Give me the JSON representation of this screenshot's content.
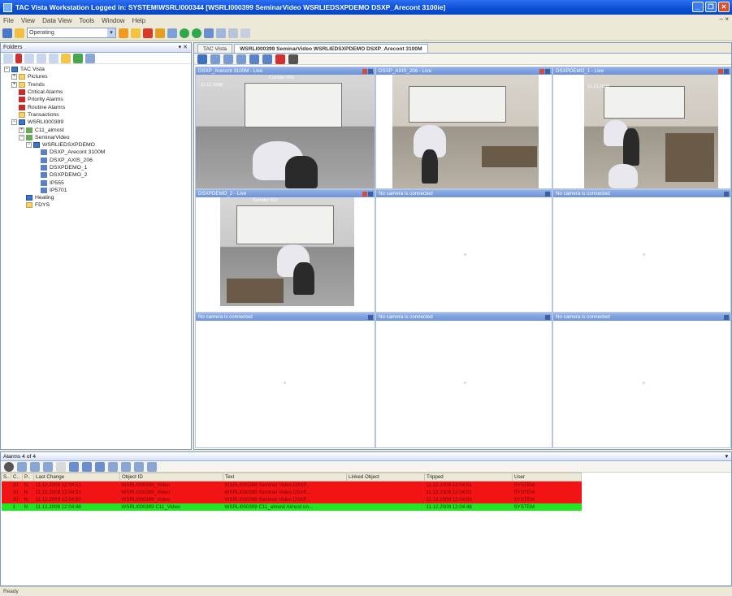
{
  "window": {
    "title": "TAC Vista Workstation   Logged in: SYSTEM\\WSRLI000344   [WSRLI000399 SeminarVideo WSRLIEDSXPDEMO DSXP_Arecont 3100ie]"
  },
  "menu": {
    "items": [
      "File",
      "View",
      "Data View",
      "Tools",
      "Window",
      "Help"
    ]
  },
  "toolbar": {
    "mode_value": "Operating"
  },
  "folders": {
    "title": "Folders",
    "tree": [
      {
        "label": "TAC Vista",
        "icon": "comp",
        "depth": 0,
        "expander": "−"
      },
      {
        "label": "Pictures",
        "icon": "folder",
        "depth": 1,
        "expander": "+"
      },
      {
        "label": "Trends",
        "icon": "folder",
        "depth": 1,
        "expander": "+"
      },
      {
        "label": "Critical Alarms",
        "icon": "alarm",
        "depth": 1,
        "expander": ""
      },
      {
        "label": "Priority Alarms",
        "icon": "alarm",
        "depth": 1,
        "expander": ""
      },
      {
        "label": "Routine Alarms",
        "icon": "alarm",
        "depth": 1,
        "expander": ""
      },
      {
        "label": "Transactions",
        "icon": "folder",
        "depth": 1,
        "expander": ""
      },
      {
        "label": "WSRLI000399",
        "icon": "comp",
        "depth": 1,
        "expander": "−"
      },
      {
        "label": "C11_almost",
        "icon": "net",
        "depth": 2,
        "expander": "+"
      },
      {
        "label": "SeminarVideo",
        "icon": "net",
        "depth": 2,
        "expander": "−"
      },
      {
        "label": "WSRLIEDSXPDEMO",
        "icon": "comp",
        "depth": 3,
        "expander": "−"
      },
      {
        "label": "DSXP_Arecont 3100M",
        "icon": "cam",
        "depth": 4,
        "expander": ""
      },
      {
        "label": "DSXP_AXIS_206",
        "icon": "cam",
        "depth": 4,
        "expander": ""
      },
      {
        "label": "DSXPDEMO_1",
        "icon": "cam",
        "depth": 4,
        "expander": ""
      },
      {
        "label": "DSXPDEMO_2",
        "icon": "cam",
        "depth": 4,
        "expander": ""
      },
      {
        "label": "IP555",
        "icon": "cam",
        "depth": 4,
        "expander": ""
      },
      {
        "label": "IP5701",
        "icon": "cam",
        "depth": 4,
        "expander": ""
      },
      {
        "label": "Heating",
        "icon": "comp",
        "depth": 2,
        "expander": ""
      },
      {
        "label": "FDYS",
        "icon": "folder",
        "depth": 2,
        "expander": ""
      }
    ]
  },
  "video": {
    "tabs": [
      "TAC Vista",
      "WSRLI000399 SeminarVideo WSRLIEDSXPDEMO DSXP_Arecont 3100M"
    ],
    "cells": [
      {
        "title": "DSXP_Arecont 3100M - Live",
        "osd": "11.12.2008",
        "osd2": "Corridor 003"
      },
      {
        "title": "DSXP_AXIS_206 - Live",
        "osd": "",
        "osd2": ""
      },
      {
        "title": "DSXPDEMO_1 - Live",
        "osd": "11.12.2008",
        "osd2": ""
      },
      {
        "title": "DSXPDEMO_2 - Live",
        "osd": "",
        "osd2": "Corridor 003"
      },
      {
        "title": "No camera is connected",
        "osd": "",
        "osd2": ""
      },
      {
        "title": "No camera is connected",
        "osd": "",
        "osd2": ""
      },
      {
        "title": "No camera is connected",
        "osd": "",
        "osd2": ""
      },
      {
        "title": "No camera is connected",
        "osd": "",
        "osd2": ""
      },
      {
        "title": "No camera is connected",
        "osd": "",
        "osd2": ""
      }
    ]
  },
  "alarms": {
    "title": "Alarms 4 of 4",
    "columns": [
      "S..",
      "C..",
      "P..",
      "Last Change",
      "Object ID",
      "Text",
      "Linked Object",
      "Tripped",
      "User"
    ],
    "rows": [
      {
        "status": "red",
        "cells": [
          "",
          "10",
          "N",
          "11.12.2008 12:04:51",
          "WSRLI000399_Video",
          "WSRLI000399 Seminar Video DSXP...",
          "",
          "11.12.2008 12:04:51",
          "SYSTEM"
        ]
      },
      {
        "status": "red",
        "cells": [
          "",
          "10",
          "N",
          "11.12.2008 12:04:51",
          "WSRLI000399_Video",
          "WSRLI000399 Seminar Video DSXP...",
          "",
          "11.12.2008 12:04:51",
          "SYSTEM"
        ]
      },
      {
        "status": "red",
        "cells": [
          "",
          "10",
          "N",
          "11.12.2008 12:04:50",
          "WSRLI000399_Video",
          "WSRLI000399 Seminar Video DSXP...",
          "",
          "11.12.2008 12:04:50",
          "SYSTEM"
        ]
      },
      {
        "status": "green",
        "cells": [
          "",
          "1",
          "N",
          "11.12.2008 12:04:48",
          "WSRLI000399 C11_Video",
          "WSRLI000399 C11_almost Almost on...",
          "",
          "11.12.2008 12:04:48",
          "SYSTEM"
        ]
      }
    ]
  },
  "status": {
    "text": "Ready"
  }
}
